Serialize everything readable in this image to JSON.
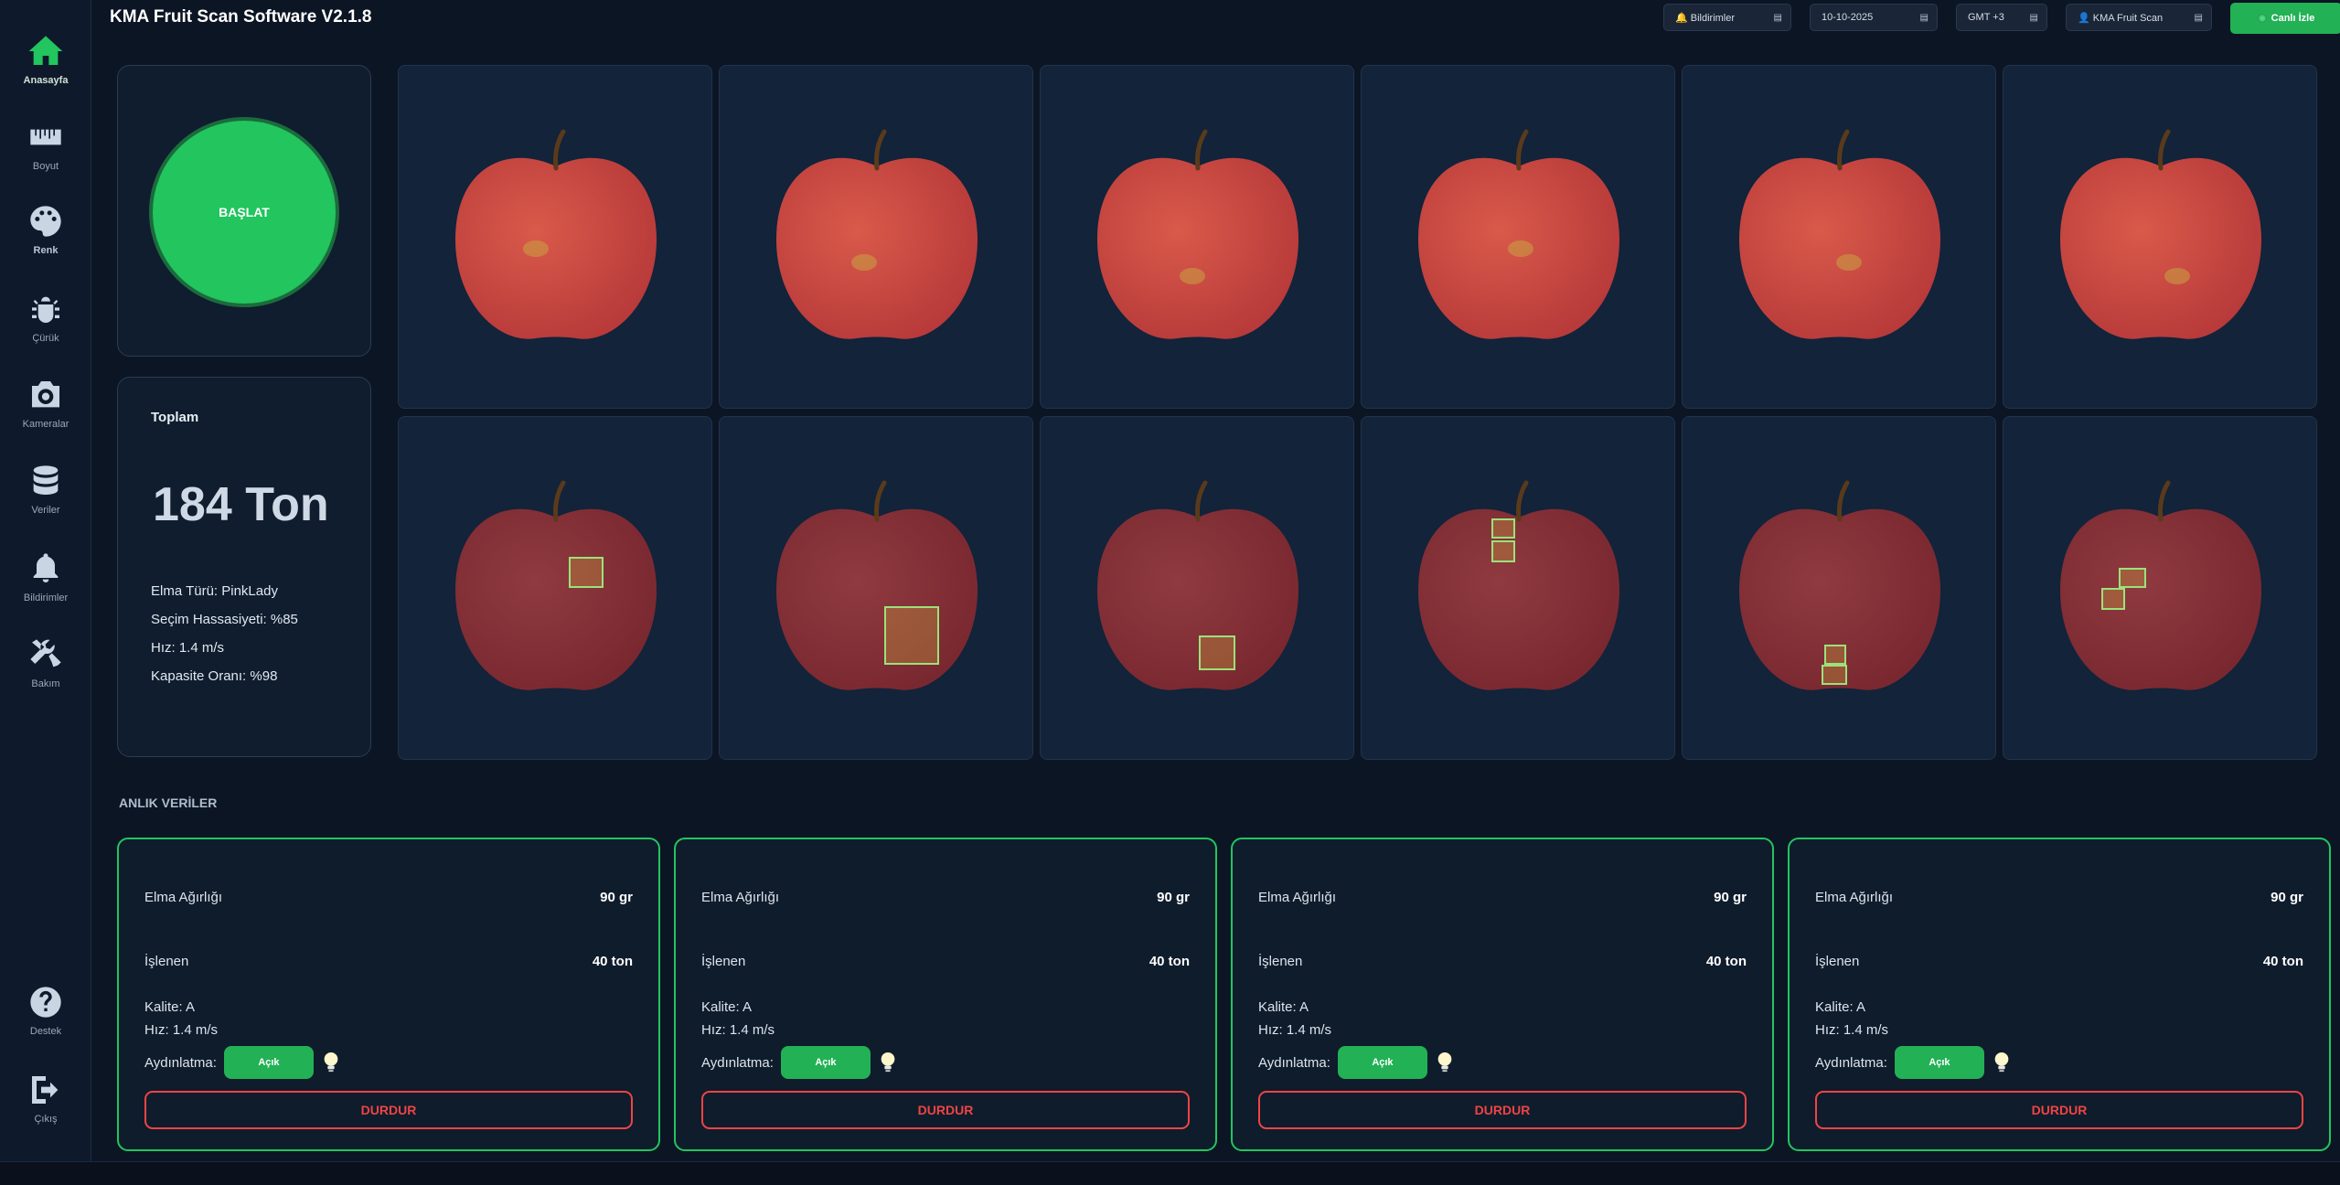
{
  "app": {
    "title": "KMA Fruit Scan Software  V2.1.8"
  },
  "header": {
    "notifications": "🔔 Bildirimler",
    "date": "10-10-2025",
    "timezone": "GMT +3",
    "user": "👤 KMA Fruit Scan",
    "caret": "▤",
    "live_label": "Canlı İzle"
  },
  "sidebar": {
    "top": [
      {
        "label": "Anasayfa",
        "icon": "home-icon"
      },
      {
        "label": "Boyut",
        "icon": "ruler-icon"
      },
      {
        "label": "Renk",
        "icon": "palette-icon"
      },
      {
        "label": "Çürük",
        "icon": "bug-icon"
      },
      {
        "label": "Kameralar",
        "icon": "camera-icon"
      },
      {
        "label": "Veriler",
        "icon": "database-icon"
      },
      {
        "label": "Bildirimler",
        "icon": "bell-icon"
      },
      {
        "label": "Bakım",
        "icon": "tools-icon"
      }
    ],
    "bottom": [
      {
        "label": "Destek",
        "icon": "help-icon"
      },
      {
        "label": "Çıkış",
        "icon": "logout-icon"
      }
    ]
  },
  "start": {
    "label": "BAŞLAT"
  },
  "summary": {
    "label": "Toplam",
    "value": "184 Ton",
    "lines": [
      "Elma Türü: PinkLady",
      "Seçim Hassasiyeti: %85",
      "Hız: 1.4 m/s",
      "Kapasite Oranı: %98"
    ]
  },
  "colors": {
    "accent": "#22c55e",
    "danger": "#ef4444",
    "background": "#0c1524"
  },
  "section": {
    "title": "ANLIK VERİLER"
  },
  "cards": [
    {
      "weight_label": "Elma Ağırlığı",
      "weight": "90 gr",
      "processed_label": "İşlenen",
      "processed": "40 ton",
      "quality": "Kalite: A",
      "speed": "Hız: 1.4 m/s",
      "light_label": "Aydınlatma:",
      "light_state": "Açık",
      "stop": "DURDUR"
    },
    {
      "weight_label": "Elma Ağırlığı",
      "weight": "90 gr",
      "processed_label": "İşlenen",
      "processed": "40 ton",
      "quality": "Kalite: A",
      "speed": "Hız: 1.4 m/s",
      "light_label": "Aydınlatma:",
      "light_state": "Açık",
      "stop": "DURDUR"
    },
    {
      "weight_label": "Elma Ağırlığı",
      "weight": "90 gr",
      "processed_label": "İşlenen",
      "processed": "40 ton",
      "quality": "Kalite: A",
      "speed": "Hız: 1.4 m/s",
      "light_label": "Aydınlatma:",
      "light_state": "Açık",
      "stop": "DURDUR"
    },
    {
      "weight_label": "Elma Ağırlığı",
      "weight": "90 gr",
      "processed_label": "İşlenen",
      "processed": "40 ton",
      "quality": "Kalite: A",
      "speed": "Hız: 1.4 m/s",
      "light_label": "Aydınlatma:",
      "light_state": "Açık",
      "stop": "DURDUR"
    }
  ]
}
